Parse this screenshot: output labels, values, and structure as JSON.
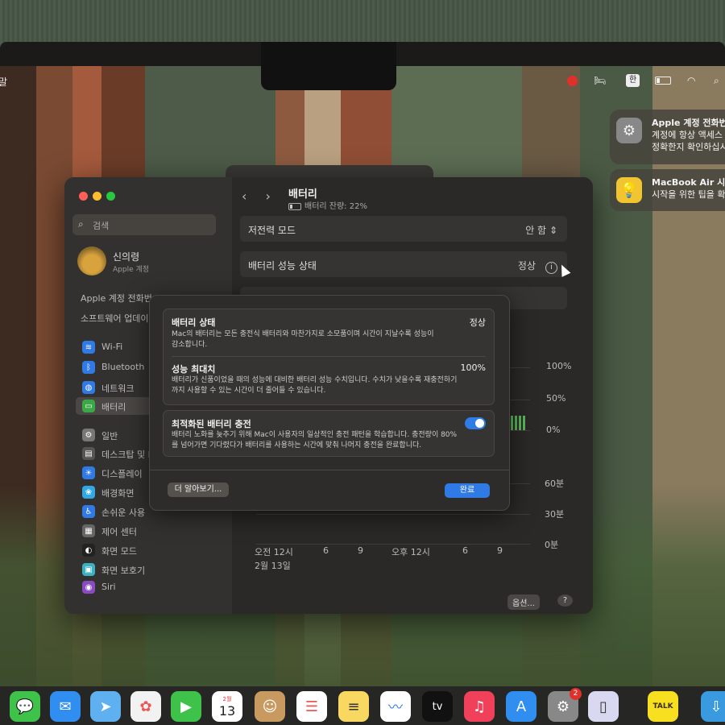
{
  "menubar": {
    "app_fragment": "말",
    "keyboard": "한"
  },
  "notifications": [
    {
      "title": "Apple 계정 전화번",
      "body1": "계정에 항상 액세스",
      "body2": "정확한지 확인하십시"
    },
    {
      "title": "MacBook Air 시작",
      "body1": "시작을 위한 팁을 확"
    }
  ],
  "sidebar": {
    "search_placeholder": "검색",
    "account_name": "신의령",
    "account_sub": "Apple 계정",
    "apple_phone": "Apple 계정 전화번",
    "software_update": "소프트웨어 업데이",
    "items": [
      {
        "label": "Wi-Fi",
        "color": "#2f7ae5",
        "glyph": "≋"
      },
      {
        "label": "Bluetooth",
        "color": "#2f7ae5",
        "glyph": "ᛒ"
      },
      {
        "label": "네트워크",
        "color": "#2f7ae5",
        "glyph": "◍"
      },
      {
        "label": "배터리",
        "color": "#3aa845",
        "glyph": "▭"
      },
      {
        "label": "일반",
        "color": "#777",
        "glyph": "⚙"
      },
      {
        "label": "데스크탑 및 D",
        "color": "#555",
        "glyph": "▤"
      },
      {
        "label": "디스플레이",
        "color": "#2f7ae5",
        "glyph": "☀"
      },
      {
        "label": "배경화면",
        "color": "#2fa8e5",
        "glyph": "❀"
      },
      {
        "label": "손쉬운 사용",
        "color": "#2f7ae5",
        "glyph": "♿"
      },
      {
        "label": "제어 센터",
        "color": "#666",
        "glyph": "▦"
      },
      {
        "label": "화면 모드",
        "color": "#222",
        "glyph": "◐"
      },
      {
        "label": "화면 보호기",
        "color": "#3ab0c0",
        "glyph": "▣"
      },
      {
        "label": "Siri",
        "color": "#8a4ac0",
        "glyph": "◉"
      }
    ]
  },
  "main": {
    "title": "배터리",
    "subtitle": "배터리 잔량: 22%",
    "battery_level": 0.22,
    "low_power_label": "저전력 모드",
    "low_power_value": "안 함",
    "health_label": "배터리 성능 상태",
    "health_value": "정상",
    "chart_y_top": [
      "100%",
      "50%",
      "0%"
    ],
    "chart_y_bottom": [
      "60분",
      "30분",
      "0분"
    ],
    "chart_x": [
      "오전 12시",
      "6",
      "9",
      "오후 12시",
      "6",
      "9"
    ],
    "chart_date": "2월 13일",
    "options_button": "옵션...",
    "help_button": "?"
  },
  "sheet": {
    "status_title": "배터리 상태",
    "status_value": "정상",
    "status_desc": "Mac의 배터리는 모든 충전식 배터리와 마찬가지로 소모품이며 시간이 지날수록 성능이 감소합니다.",
    "capacity_title": "성능 최대치",
    "capacity_value": "100%",
    "capacity_desc": "배터리가 신품이었을 때의 성능에 대비한 배터리 성능 수치입니다. 수치가 낮을수록 재충전하기까지 사용할 수 있는 시간이 더 줄어들 수 있습니다.",
    "optimized_title": "최적화된 배터리 충전",
    "optimized_enabled": true,
    "optimized_desc": "배터리 노화를 늦추기 위해 Mac이 사용자의 일상적인 충전 패턴을 학습합니다. 충전량이 80%를 넘어가면 기다렸다가 배터리를 사용하는 시간에 맞춰 나머지 충전을 완료합니다.",
    "learn_more": "더 알아보기...",
    "done": "완료"
  },
  "dock": {
    "calendar_month": "2월",
    "calendar_day": "13",
    "appletv_label": "tv",
    "kakaotalk_label": "TALK",
    "settings_badge": "2"
  }
}
